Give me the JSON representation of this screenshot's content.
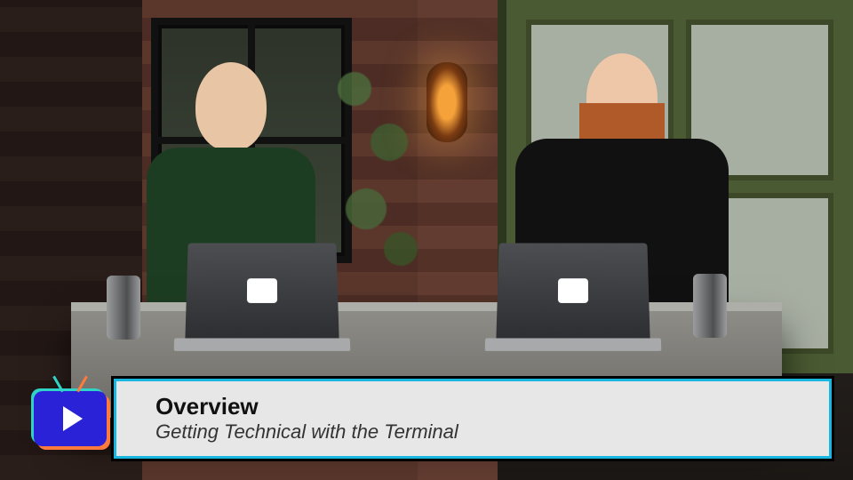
{
  "lower_third": {
    "title": "Overview",
    "subtitle": "Getting Technical with the Terminal",
    "icon": "play-tv-icon"
  }
}
